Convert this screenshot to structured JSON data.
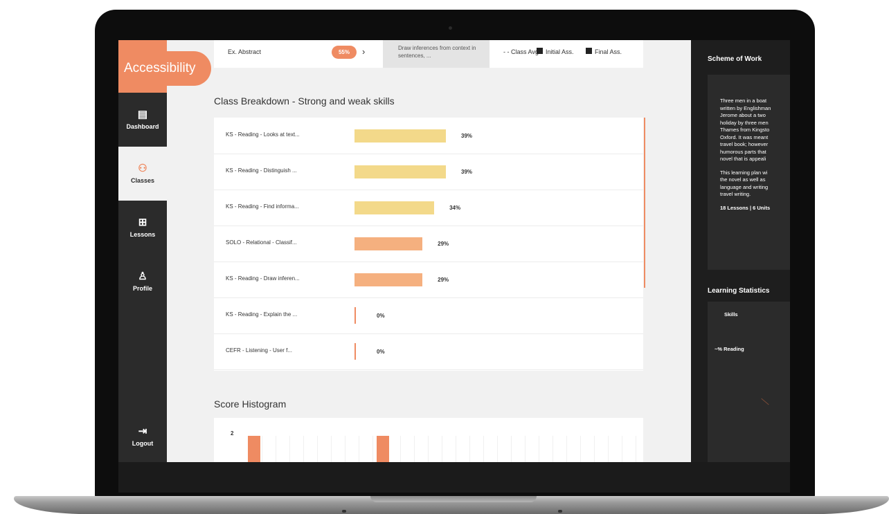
{
  "sidebar": {
    "accessibility_label": "Accessibility",
    "items": [
      {
        "label": "Dashboard",
        "icon": "calendar-icon",
        "glyph": "▤"
      },
      {
        "label": "Classes",
        "icon": "users-icon",
        "glyph": "⚇"
      },
      {
        "label": "Lessons",
        "icon": "lessons-icon",
        "glyph": "⊞"
      },
      {
        "label": "Profile",
        "icon": "user-icon",
        "glyph": "♙"
      },
      {
        "label": "Logout",
        "icon": "logout-icon",
        "glyph": "⇥"
      }
    ]
  },
  "top_card": {
    "ex_label": "Ex. Abstract",
    "badge": "55%",
    "chevron": "›",
    "inference_text": "Draw inferences from context in sentences, ...",
    "class_avg": "- - Class Avg.",
    "initial_ass": "Initial Ass.",
    "final_ass": "Final Ass."
  },
  "breakdown": {
    "title": "Class Breakdown - Strong and weak skills",
    "skills": [
      {
        "label": "KS - Reading - Looks at text...",
        "value": 39,
        "pct": "39%"
      },
      {
        "label": "KS - Reading - Distinguish ...",
        "value": 39,
        "pct": "39%"
      },
      {
        "label": "KS - Reading - Find informa...",
        "value": 34,
        "pct": "34%"
      },
      {
        "label": "SOLO - Relational - Classif...",
        "value": 29,
        "pct": "29%"
      },
      {
        "label": "KS - Reading - Draw inferen...",
        "value": 29,
        "pct": "29%"
      },
      {
        "label": "KS - Reading - Explain the ...",
        "value": 0,
        "pct": "0%"
      },
      {
        "label": "CEFR - Listening - User f...",
        "value": 0,
        "pct": "0%"
      }
    ]
  },
  "histogram": {
    "title": "Score Histogram",
    "y_top": "2"
  },
  "colors": {
    "accent": "#ef8b62",
    "bar_yellow": "#f3d98a",
    "bar_orange": "#f5b07f",
    "sidebar": "#2b2b2b",
    "panel": "#1e1e1e"
  },
  "right_panel": {
    "scheme_title": "Scheme of Work",
    "scheme_lines": [
      "Three men in a boat",
      "written by Englishman",
      "Jerome about a two",
      "holiday by three men",
      "Thames from Kingsto",
      "Oxford. It was meant",
      "travel book; however",
      "humorous parts that",
      "novel that is appeali"
    ],
    "plan_lines": [
      "This learning plan wi",
      "the novel as well as",
      "language and writing",
      "travel writing."
    ],
    "lessons_units": "18 Lessons | 6 Units",
    "stats_title": "Learning Statistics",
    "skills_label": "Skills",
    "reading_label": "~% Reading"
  }
}
